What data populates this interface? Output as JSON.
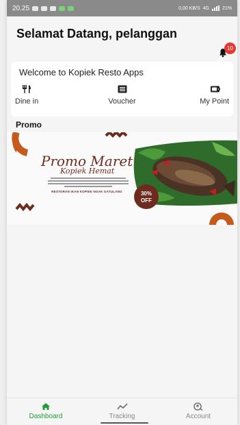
{
  "status_bar": {
    "time": "20.25",
    "network": "0,00 KB/S",
    "net_type": "4G",
    "battery": "21%"
  },
  "header": {
    "greeting": "Selamat Datang, pelanggan",
    "notification_count": "10",
    "icon": "bell-icon"
  },
  "welcome_card": {
    "title": "Welcome to Kopiek Resto Apps",
    "items": [
      {
        "label": "Dine in",
        "icon": "dine-in-icon"
      },
      {
        "label": "Voucher",
        "icon": "voucher-icon"
      },
      {
        "label": "My Point",
        "icon": "wallet-icon"
      }
    ]
  },
  "promo": {
    "heading": "Promo",
    "banner": {
      "title": "Promo Maret",
      "subtitle": "Kopiek Hemat",
      "tag": "30% OFF",
      "footer": "RESTORAN IKAN KOPIEK NGAK GATULANG"
    }
  },
  "bottom_nav": {
    "items": [
      {
        "label": "Dashboard",
        "icon": "home-icon",
        "active": true
      },
      {
        "label": "Tracking",
        "icon": "tracking-icon",
        "active": false
      },
      {
        "label": "Account",
        "icon": "account-icon",
        "active": false
      }
    ]
  },
  "colors": {
    "accent": "#1e9e3a",
    "badge": "#e53935",
    "promo_brown": "#6d2b1f",
    "promo_orange": "#c55a1c"
  }
}
